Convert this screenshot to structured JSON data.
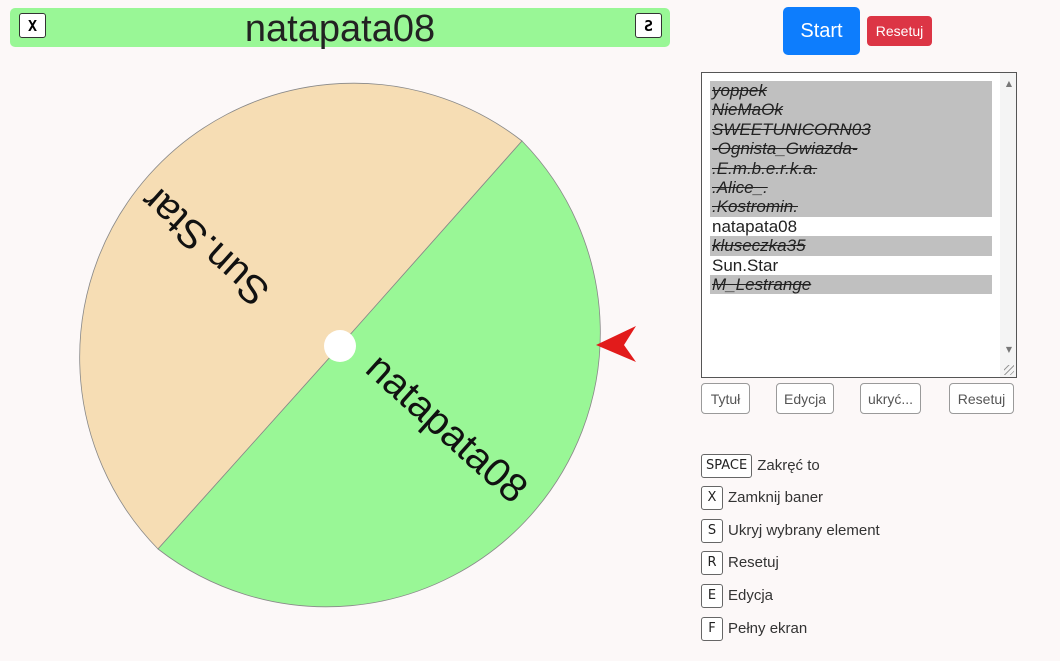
{
  "banner": {
    "title": "natapata08",
    "close_key": "X",
    "hide_key": "S"
  },
  "controls": {
    "start_label": "Start",
    "reset_label": "Resetuj"
  },
  "wheel": {
    "segments": [
      {
        "label": "Sun.Star",
        "color": "#f6ddb4"
      },
      {
        "label": "natapata08",
        "color": "#99f796"
      }
    ],
    "pointer_color": "#e21b1b"
  },
  "entries": [
    {
      "text": "yoppek",
      "hidden": true
    },
    {
      "text": "NieMaOk",
      "hidden": true
    },
    {
      "text": "SWEETUNICORN03",
      "hidden": true
    },
    {
      "text": "-Ognista_Gwiazda-",
      "hidden": true
    },
    {
      "text": ".E.m.b.e.r.k.a.",
      "hidden": true
    },
    {
      "text": ".Alice_.",
      "hidden": true
    },
    {
      "text": ".Kostromin.",
      "hidden": true
    },
    {
      "text": "natapata08",
      "hidden": false
    },
    {
      "text": "kluseczka35",
      "hidden": true
    },
    {
      "text": "Sun.Star",
      "hidden": false
    },
    {
      "text": "M_Lestrange",
      "hidden": true
    }
  ],
  "list_buttons": {
    "title_label": "Tytuł",
    "edit_label": "Edycja",
    "hide_label": "ukryć...",
    "reset_label": "Resetuj"
  },
  "shortcuts": [
    {
      "key": "SPACE",
      "label": "Zakręć to"
    },
    {
      "key": "X",
      "label": "Zamknij baner"
    },
    {
      "key": "S",
      "label": "Ukryj wybrany element"
    },
    {
      "key": "R",
      "label": "Resetuj"
    },
    {
      "key": "E",
      "label": "Edycja"
    },
    {
      "key": "F",
      "label": "Pełny ekran"
    }
  ]
}
